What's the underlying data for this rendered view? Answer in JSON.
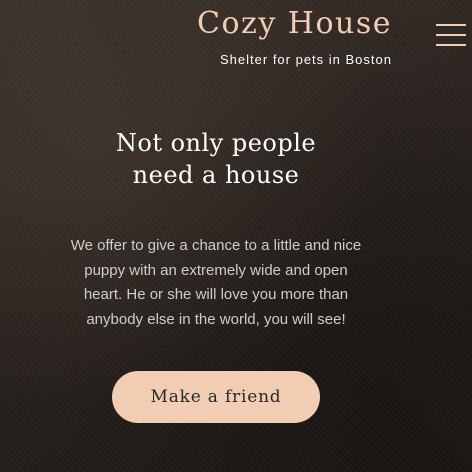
{
  "header": {
    "logo_title": "Cozy House",
    "logo_subtitle": "Shelter for pets in Boston",
    "menu_icon": "hamburger-menu-icon"
  },
  "hero": {
    "heading_lines": [
      "Not only people",
      "need a house"
    ],
    "description_lines": [
      "We offer to give a chance to a little and nice",
      "puppy with an extremely wide and open",
      "heart. He or she will love you more than",
      "anybody else in the world, you will see!"
    ],
    "cta_label": "Make a friend"
  },
  "colors": {
    "accent": "#f1cdb3",
    "background": "#2a2320",
    "heading_text": "#ffffff",
    "body_text": "#cdcdcd",
    "button_text": "#292929"
  }
}
